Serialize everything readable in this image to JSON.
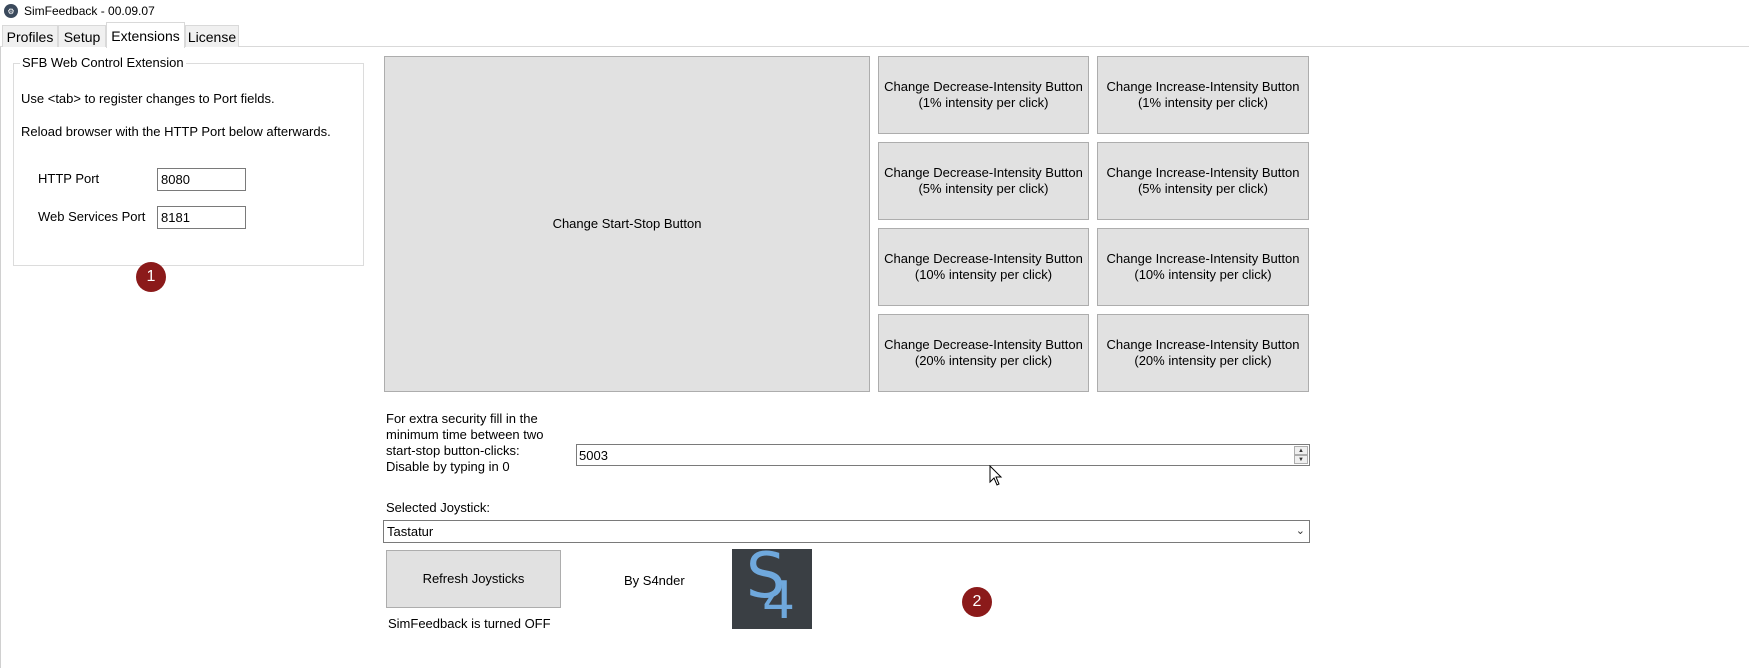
{
  "window": {
    "title": "SimFeedback - 00.09.07"
  },
  "tabs": [
    {
      "label": "Profiles"
    },
    {
      "label": "Setup"
    },
    {
      "label": "Extensions"
    },
    {
      "label": "License"
    }
  ],
  "web_control": {
    "group_title": "SFB Web Control Extension",
    "hint_tab": "Use <tab> to register changes to Port fields.",
    "hint_reload": "Reload browser with the HTTP Port below afterwards.",
    "http_port_label": "HTTP Port",
    "http_port_value": "8080",
    "ws_port_label": "Web Services Port",
    "ws_port_value": "8181"
  },
  "buttons": {
    "start_stop": "Change Start-Stop Button",
    "decrease": [
      "Change Decrease-Intensity Button (1% intensity per click)",
      "Change Decrease-Intensity Button (5% intensity per click)",
      "Change Decrease-Intensity Button (10% intensity per click)",
      "Change Decrease-Intensity Button (20% intensity per click)"
    ],
    "increase": [
      "Change Increase-Intensity Button (1% intensity per click)",
      "Change Increase-Intensity Button (5% intensity per click)",
      "Change Increase-Intensity Button (10% intensity per click)",
      "Change Increase-Intensity Button (20% intensity per click)"
    ],
    "refresh_joysticks": "Refresh Joysticks"
  },
  "security": {
    "label_lines": [
      "For extra security fill in the",
      "minimum time between two",
      "start-stop button-clicks:",
      "Disable by typing in 0"
    ],
    "value": "5003"
  },
  "joystick": {
    "label": "Selected Joystick:",
    "selected": "Tastatur"
  },
  "status": {
    "author": "By S4nder",
    "state": "SimFeedback is turned OFF"
  },
  "logo": {
    "letter_1": "S",
    "letter_2": "4"
  },
  "markers": {
    "one": "1",
    "two": "2"
  },
  "colors": {
    "marker": "#8b1a1a",
    "button_face": "#e1e1e1",
    "logo_bg": "#3a3f44",
    "logo_fg": "#6fa8dc"
  }
}
